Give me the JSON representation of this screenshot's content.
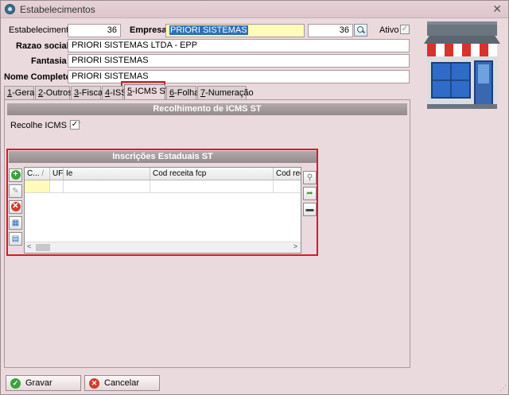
{
  "window": {
    "title": "Estabelecimentos",
    "close_glyph": "✕"
  },
  "form": {
    "estabelecimento_label": "Estabelecimento",
    "estabelecimento_value": "36",
    "empresa_label": "Empresa",
    "empresa_value": "PRIORI SISTEMAS",
    "empresa_code": "36",
    "ativo_label": "Ativo",
    "razao_label": "Razao social",
    "razao_value": "PRIORI SISTEMAS LTDA - EPP",
    "fantasia_label": "Fantasia",
    "fantasia_value": "PRIORI SISTEMAS",
    "nome_label": "Nome Completo",
    "nome_value": "PRIORI SISTEMAS",
    "check_glyph": "✓"
  },
  "tabs": [
    {
      "key": "1",
      "rest": "-Geral"
    },
    {
      "key": "2",
      "rest": "-Outros"
    },
    {
      "key": "3",
      "rest": "-Fiscal"
    },
    {
      "key": "4",
      "rest": "-ISS"
    },
    {
      "key": "5",
      "rest": "-ICMS ST"
    },
    {
      "key": "6",
      "rest": "-Folha"
    },
    {
      "key": "7",
      "rest": "-Numeração"
    }
  ],
  "icms_st": {
    "section_title": "Recolhimento de ICMS ST",
    "recolhe_label": "Recolhe ICMS ST",
    "recolhe_checked": "✓"
  },
  "inscricoes": {
    "section_title": "Inscrições Estaduais ST",
    "columns": [
      "C...",
      "UF",
      "Ie",
      "Cod receita fcp",
      "Cod rece"
    ],
    "sort_glyph": "/",
    "scroll_left": "<",
    "scroll_right": ">"
  },
  "buttons": {
    "gravar": "Gravar",
    "cancelar": "Cancelar",
    "gravar_icon_glyph": "✓",
    "cancelar_icon_glyph": "✕",
    "add_glyph": "+",
    "delete_glyph": "✕",
    "resize_glyph": "⋰"
  },
  "colors": {
    "highlight_red": "#d51b24",
    "selection_blue": "#2f6fb6",
    "section_grey": "#a59a9d",
    "required_yellow": "#fffbb8",
    "gravar_green": "#3aa43a",
    "cancelar_red": "#d33b2c"
  }
}
